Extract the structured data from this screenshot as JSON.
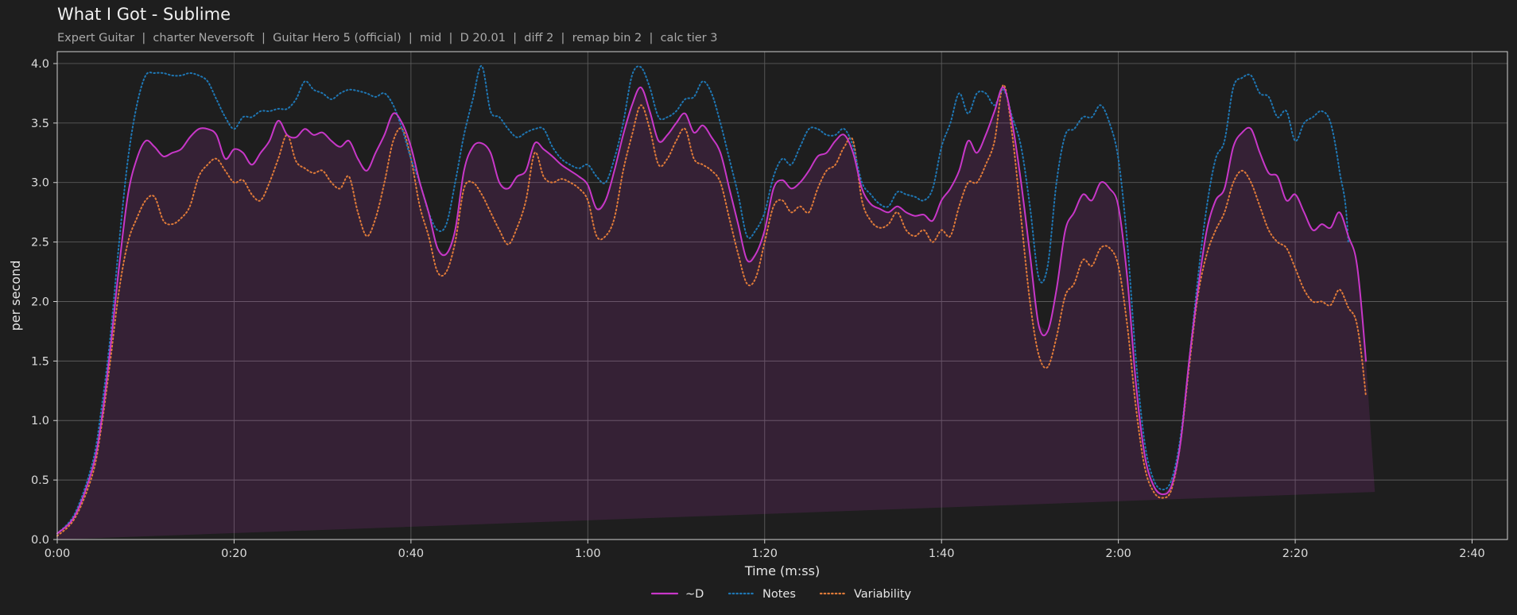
{
  "chart_data": {
    "type": "line",
    "title": "What I Got - Sublime",
    "subtitle": "Expert Guitar  |  charter Neversoft  |  Guitar Hero 5 (official)  |  mid  |  D 20.01  |  diff 2  |  remap bin 2  |  calc tier 3",
    "xlabel": "Time (m:ss)",
    "ylabel": "per second",
    "xlim": [
      0,
      164
    ],
    "ylim": [
      0,
      4.1
    ],
    "x_ticks": [
      0,
      20,
      40,
      60,
      80,
      100,
      120,
      140,
      160
    ],
    "x_tick_labels": [
      "0:00",
      "0:20",
      "0:40",
      "1:00",
      "1:20",
      "1:40",
      "2:00",
      "2:20",
      "2:40"
    ],
    "y_ticks": [
      0,
      0.5,
      1,
      1.5,
      2,
      2.5,
      3,
      3.5,
      4
    ],
    "y_tick_labels": [
      "0.0",
      "0.5",
      "1.0",
      "1.5",
      "2.0",
      "2.5",
      "3.0",
      "3.5",
      "4.0"
    ],
    "grid": true,
    "legend_position": "bottom-center",
    "x": [
      0,
      2,
      4,
      5,
      6,
      7,
      8,
      9,
      10,
      11,
      12,
      13,
      14,
      15,
      16,
      17,
      18,
      19,
      20,
      21,
      22,
      23,
      24,
      25,
      26,
      27,
      28,
      29,
      30,
      31,
      32,
      33,
      34,
      35,
      36,
      37,
      38,
      39,
      40,
      41,
      42,
      43,
      44,
      45,
      46,
      47,
      48,
      49,
      50,
      51,
      52,
      53,
      54,
      55,
      56,
      57,
      58,
      59,
      60,
      61,
      62,
      63,
      64,
      65,
      66,
      67,
      68,
      69,
      70,
      71,
      72,
      73,
      74,
      75,
      76,
      77,
      78,
      79,
      80,
      81,
      82,
      83,
      84,
      85,
      86,
      87,
      88,
      89,
      90,
      91,
      92,
      93,
      94,
      95,
      96,
      97,
      98,
      99,
      100,
      101,
      102,
      103,
      104,
      105,
      106,
      107,
      108,
      109,
      110,
      111,
      112,
      113,
      114,
      115,
      116,
      117,
      118,
      119,
      120,
      121,
      122,
      123,
      124,
      125,
      126,
      127,
      128,
      129,
      130,
      131,
      132,
      133,
      134,
      135,
      136,
      137,
      138,
      139,
      140,
      141,
      142,
      143,
      144,
      145,
      146,
      147,
      148,
      149,
      150,
      151,
      152,
      153,
      154,
      155,
      156,
      157,
      158,
      159,
      160,
      161,
      162,
      163,
      164
    ],
    "series": [
      {
        "name": "~D",
        "color": "#c837c8",
        "style": "solid",
        "values": [
          0.05,
          0.2,
          0.6,
          1.0,
          1.6,
          2.3,
          2.9,
          3.2,
          3.35,
          3.3,
          3.22,
          3.25,
          3.28,
          3.38,
          3.45,
          3.45,
          3.4,
          3.2,
          3.28,
          3.25,
          3.15,
          3.25,
          3.35,
          3.52,
          3.4,
          3.38,
          3.45,
          3.4,
          3.42,
          3.35,
          3.3,
          3.35,
          3.2,
          3.1,
          3.25,
          3.4,
          3.58,
          3.5,
          3.3,
          3.0,
          2.75,
          2.45,
          2.4,
          2.6,
          3.1,
          3.3,
          3.33,
          3.25,
          3.0,
          2.95,
          3.05,
          3.1,
          3.33,
          3.28,
          3.22,
          3.15,
          3.1,
          3.05,
          2.98,
          2.78,
          2.85,
          3.1,
          3.4,
          3.65,
          3.8,
          3.6,
          3.35,
          3.4,
          3.5,
          3.58,
          3.42,
          3.48,
          3.38,
          3.25,
          2.95,
          2.65,
          2.35,
          2.4,
          2.6,
          2.95,
          3.02,
          2.95,
          3.0,
          3.1,
          3.22,
          3.25,
          3.35,
          3.4,
          3.25,
          2.95,
          2.82,
          2.78,
          2.75,
          2.8,
          2.75,
          2.72,
          2.73,
          2.68,
          2.85,
          2.95,
          3.1,
          3.35,
          3.25,
          3.4,
          3.6,
          3.8,
          3.5,
          3.0,
          2.4,
          1.8,
          1.75,
          2.1,
          2.6,
          2.75,
          2.9,
          2.85,
          3.0,
          2.95,
          2.8,
          2.2,
          1.3,
          0.7,
          0.45,
          0.38,
          0.45,
          0.8,
          1.5,
          2.1,
          2.6,
          2.85,
          2.95,
          3.3,
          3.42,
          3.45,
          3.25,
          3.08,
          3.05,
          2.85,
          2.9,
          2.75,
          2.6,
          2.65,
          2.62,
          2.75,
          2.55,
          2.3,
          1.5,
          0.4
        ]
      },
      {
        "name": "Notes",
        "color": "#1f77b4",
        "style": "dotted",
        "values": [
          0.05,
          0.22,
          0.65,
          1.1,
          1.7,
          2.5,
          3.2,
          3.65,
          3.9,
          3.92,
          3.92,
          3.9,
          3.9,
          3.92,
          3.9,
          3.85,
          3.7,
          3.55,
          3.45,
          3.55,
          3.55,
          3.6,
          3.6,
          3.62,
          3.62,
          3.7,
          3.85,
          3.78,
          3.75,
          3.7,
          3.75,
          3.78,
          3.77,
          3.75,
          3.72,
          3.75,
          3.65,
          3.45,
          3.2,
          3.0,
          2.75,
          2.6,
          2.65,
          3.0,
          3.4,
          3.7,
          3.98,
          3.6,
          3.55,
          3.45,
          3.38,
          3.42,
          3.45,
          3.45,
          3.3,
          3.2,
          3.15,
          3.12,
          3.15,
          3.05,
          3.0,
          3.2,
          3.5,
          3.9,
          3.97,
          3.8,
          3.55,
          3.55,
          3.6,
          3.7,
          3.72,
          3.85,
          3.75,
          3.5,
          3.2,
          2.9,
          2.55,
          2.6,
          2.75,
          3.05,
          3.2,
          3.15,
          3.3,
          3.45,
          3.45,
          3.4,
          3.4,
          3.45,
          3.3,
          3.0,
          2.9,
          2.82,
          2.8,
          2.92,
          2.9,
          2.88,
          2.85,
          2.95,
          3.3,
          3.5,
          3.75,
          3.58,
          3.75,
          3.75,
          3.65,
          3.78,
          3.55,
          3.3,
          2.8,
          2.2,
          2.3,
          3.0,
          3.4,
          3.45,
          3.55,
          3.55,
          3.65,
          3.5,
          3.2,
          2.5,
          1.5,
          0.8,
          0.5,
          0.42,
          0.5,
          0.85,
          1.5,
          2.2,
          2.8,
          3.2,
          3.35,
          3.8,
          3.88,
          3.9,
          3.75,
          3.72,
          3.55,
          3.6,
          3.35,
          3.5,
          3.55,
          3.6,
          3.5,
          3.1,
          2.5,
          0.35
        ]
      },
      {
        "name": "Variability",
        "color": "#e07b39",
        "style": "dotted",
        "values": [
          0.03,
          0.18,
          0.55,
          0.95,
          1.5,
          2.1,
          2.5,
          2.7,
          2.85,
          2.88,
          2.68,
          2.65,
          2.7,
          2.8,
          3.05,
          3.15,
          3.2,
          3.1,
          3.0,
          3.02,
          2.9,
          2.85,
          3.0,
          3.2,
          3.4,
          3.18,
          3.12,
          3.08,
          3.1,
          3.0,
          2.95,
          3.05,
          2.75,
          2.55,
          2.7,
          3.0,
          3.35,
          3.45,
          3.2,
          2.8,
          2.55,
          2.25,
          2.25,
          2.5,
          2.95,
          3.0,
          2.9,
          2.75,
          2.6,
          2.48,
          2.62,
          2.85,
          3.25,
          3.05,
          3.0,
          3.03,
          3.0,
          2.95,
          2.85,
          2.55,
          2.55,
          2.7,
          3.1,
          3.4,
          3.65,
          3.45,
          3.15,
          3.2,
          3.35,
          3.45,
          3.2,
          3.15,
          3.1,
          3.0,
          2.7,
          2.4,
          2.15,
          2.2,
          2.5,
          2.8,
          2.85,
          2.75,
          2.8,
          2.75,
          2.95,
          3.1,
          3.15,
          3.3,
          3.35,
          2.85,
          2.68,
          2.62,
          2.65,
          2.75,
          2.6,
          2.55,
          2.6,
          2.5,
          2.6,
          2.55,
          2.8,
          3.0,
          3.0,
          3.15,
          3.35,
          3.82,
          3.4,
          2.7,
          2.0,
          1.55,
          1.45,
          1.7,
          2.05,
          2.15,
          2.35,
          2.3,
          2.45,
          2.45,
          2.3,
          1.8,
          1.1,
          0.6,
          0.4,
          0.35,
          0.42,
          0.8,
          1.45,
          2.05,
          2.4,
          2.6,
          2.75,
          3.0,
          3.1,
          3.0,
          2.8,
          2.6,
          2.5,
          2.45,
          2.28,
          2.1,
          2.0,
          2.0,
          1.97,
          2.1,
          1.95,
          1.8,
          1.2,
          0.3
        ]
      }
    ]
  }
}
